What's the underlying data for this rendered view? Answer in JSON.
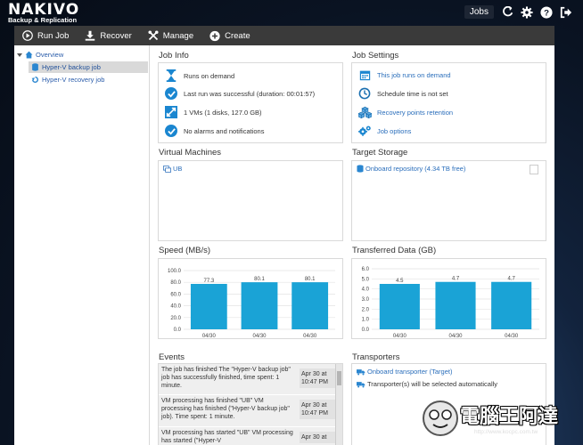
{
  "app": {
    "name": "NAKIVO",
    "subtitle": "Backup & Replication"
  },
  "top_nav": {
    "jobs_label": "Jobs",
    "icons": [
      "refresh-icon",
      "gear-icon",
      "help-icon",
      "logout-icon"
    ]
  },
  "toolbar": {
    "run_job": "Run Job",
    "recover": "Recover",
    "manage": "Manage",
    "create": "Create"
  },
  "sidebar": {
    "items": [
      {
        "label": "Overview",
        "icon": "home-icon"
      },
      {
        "label": "Hyper-V backup job",
        "icon": "database-icon",
        "selected": true
      },
      {
        "label": "Hyper-V recovery job",
        "icon": "restore-icon"
      }
    ]
  },
  "job_info": {
    "title": "Job Info",
    "items": [
      {
        "text": "Runs on demand",
        "icon": "hourglass-icon"
      },
      {
        "text": "Last run was successful (duration: 00:01:57)",
        "icon": "check-circle-icon"
      },
      {
        "text": "1 VMs (1 disks, 127.0 GB)",
        "icon": "resize-icon"
      },
      {
        "text": "No alarms and notifications",
        "icon": "check-circle-icon"
      }
    ]
  },
  "job_settings": {
    "title": "Job Settings",
    "items": [
      {
        "text": "This job runs on demand",
        "icon": "calendar-icon",
        "link": true
      },
      {
        "text": "Schedule time is not set",
        "icon": "clock-icon",
        "link": false
      },
      {
        "text": "Recovery points retention",
        "icon": "cubes-icon",
        "link": true
      },
      {
        "text": "Job options",
        "icon": "gears-icon",
        "link": true
      }
    ]
  },
  "virtual_machines": {
    "title": "Virtual Machines",
    "items": [
      "UB"
    ]
  },
  "target_storage": {
    "title": "Target Storage",
    "items": [
      "Onboard repository (4.34 TB free)"
    ]
  },
  "speed": {
    "title": "Speed (MB/s)"
  },
  "transferred": {
    "title": "Transferred Data (GB)"
  },
  "chart_data": [
    {
      "type": "bar",
      "title": "Speed (MB/s)",
      "categories": [
        "04/30",
        "04/30",
        "04/30"
      ],
      "values": [
        77.3,
        80.1,
        80.1
      ],
      "ylim": [
        0,
        100
      ],
      "yticks": [
        "0.0",
        "20.0",
        "40.0",
        "60.0",
        "80.0",
        "100.0"
      ],
      "color": "#1aa3d6",
      "grid": true
    },
    {
      "type": "bar",
      "title": "Transferred Data (GB)",
      "categories": [
        "04/30",
        "04/30",
        "04/30"
      ],
      "values": [
        4.5,
        4.7,
        4.7
      ],
      "ylim": [
        0,
        6
      ],
      "yticks": [
        "0.0",
        "1.0",
        "2.0",
        "3.0",
        "4.0",
        "5.0",
        "6.0"
      ],
      "color": "#1aa3d6",
      "grid": true
    }
  ],
  "events": {
    "title": "Events",
    "items": [
      {
        "text": "The job has finished The \"Hyper-V backup job\" job has successfully finished, time spent: 1 minute.",
        "date": "Apr 30 at 10:47 PM"
      },
      {
        "text": "VM processing has finished \"UB\" VM processing has finished (\"Hyper-V backup job\" job). Time spent: 1 minute.",
        "date": "Apr 30 at 10:47 PM"
      },
      {
        "text": "VM processing has started \"UB\" VM processing has started (\"Hyper-V",
        "date": "Apr 30 at"
      }
    ]
  },
  "transporters": {
    "title": "Transporters",
    "items": [
      {
        "text": "Onboard transporter (Target)",
        "link": true
      },
      {
        "text": "Transporter(s) will be selected automatically",
        "link": false
      }
    ]
  },
  "watermark": {
    "text": "電腦王阿達",
    "url": "http://www.kocpc.com.tw"
  }
}
